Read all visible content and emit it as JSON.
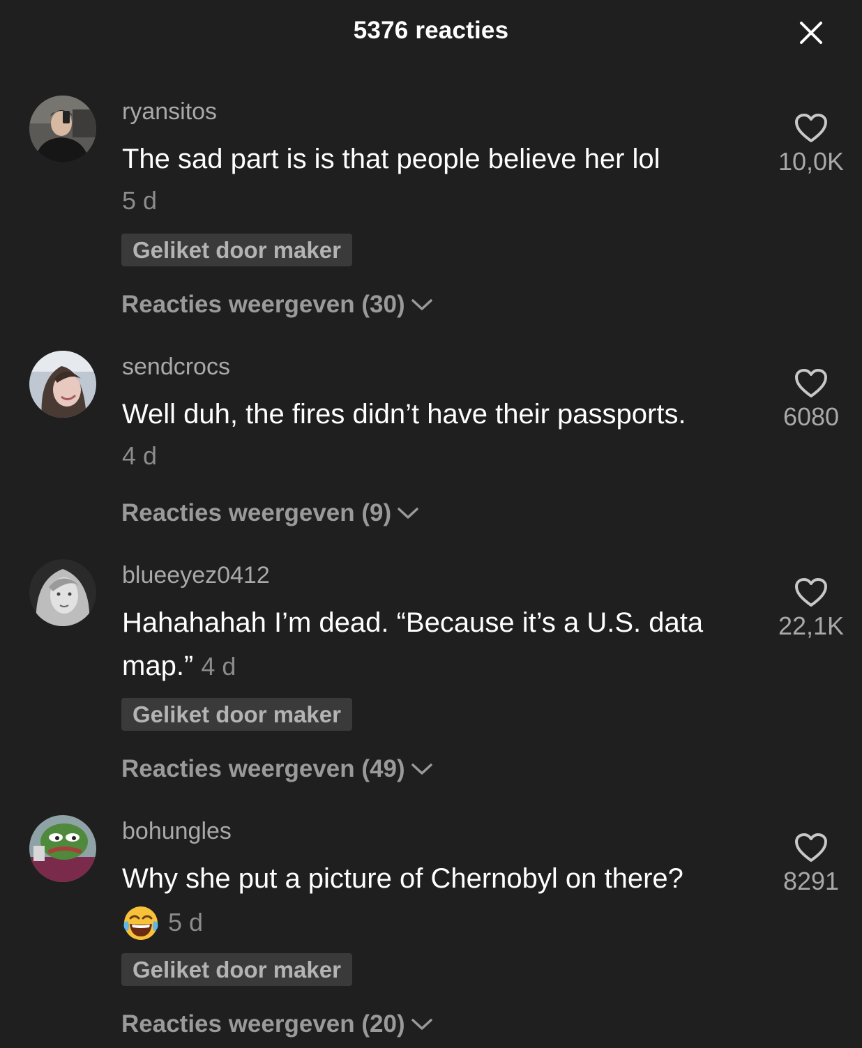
{
  "header": {
    "title": "5376 reacties"
  },
  "comments": [
    {
      "username": "ryansitos",
      "text": "The sad part is is that people believe her lol",
      "time": "5 d",
      "liked_by_creator": "Geliket door maker",
      "view_replies": "Reacties weergeven (30)",
      "likes": "10,0K"
    },
    {
      "username": "sendcrocs",
      "text": "Well duh, the fires didn’t have their passports.",
      "time": "4 d",
      "view_replies": "Reacties weergeven (9)",
      "likes": "6080"
    },
    {
      "username": "blueeyez0412",
      "text": "Hahahahah I’m dead. “Because it’s a U.S. data map.”",
      "time": "4 d",
      "liked_by_creator": "Geliket door maker",
      "view_replies": "Reacties weergeven (49)",
      "likes": "22,1K"
    },
    {
      "username": "bohungles",
      "text": "Why she put a picture of Chernobyl on there?",
      "time": "5 d",
      "liked_by_creator": "Geliket door maker",
      "view_replies": "Reacties weergeven (20)",
      "likes": "8291"
    }
  ]
}
